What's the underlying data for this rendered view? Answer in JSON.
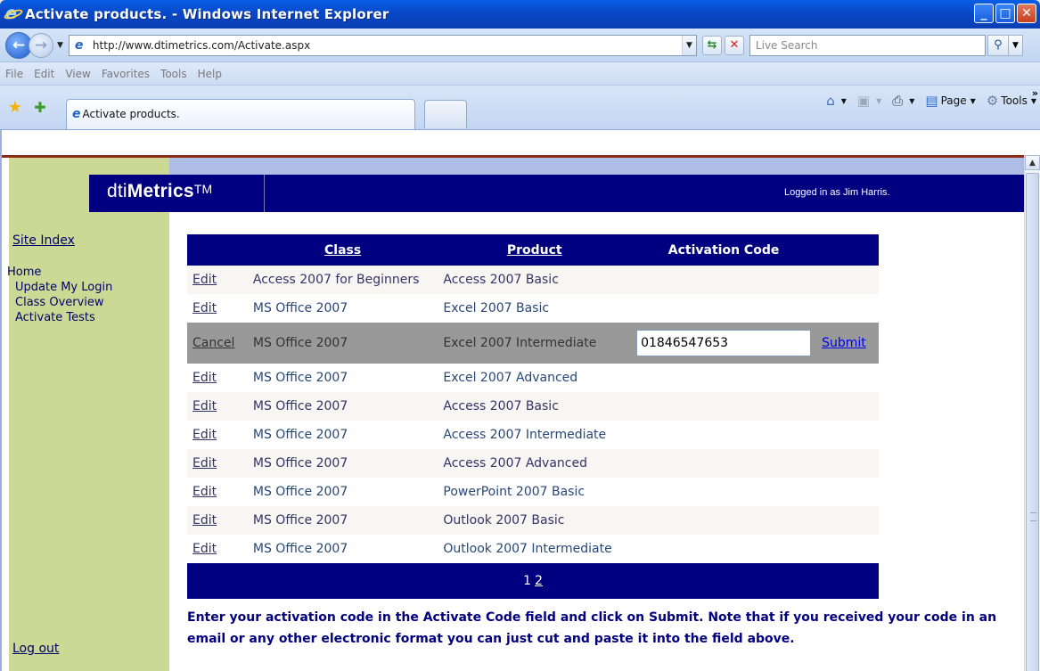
{
  "window": {
    "title": "Activate products. - Windows Internet Explorer"
  },
  "address_bar": {
    "url": "http://www.dtimetrics.com/Activate.aspx",
    "search_placeholder": "Live Search"
  },
  "menu": [
    "File",
    "Edit",
    "View",
    "Favorites",
    "Tools",
    "Help"
  ],
  "tabs": {
    "active_title": "Activate products."
  },
  "command_bar": {
    "page_label": "Page",
    "tools_label": "Tools"
  },
  "site": {
    "logo_prefix": "dti",
    "logo_bold": "Metrics",
    "logo_tm": "TM",
    "logged_in": "Logged in as Jim Harris."
  },
  "sidebar": {
    "site_index": "Site Index",
    "home": "Home",
    "items": [
      "Update My Login",
      "Class Overview",
      "Activate Tests"
    ],
    "logout": "Log out"
  },
  "grid": {
    "headers": {
      "class": "Class",
      "product": "Product",
      "activation_code": "Activation Code"
    },
    "rows": [
      {
        "action": "Edit",
        "class": "Access 2007 for Beginners",
        "product": "Access 2007 Basic"
      },
      {
        "action": "Edit",
        "class": "MS Office 2007",
        "product": "Excel 2007 Basic"
      },
      {
        "action": "Cancel",
        "class": "MS Office 2007",
        "product": "Excel 2007 Intermediate",
        "code": "01846547653",
        "submit": "Submit"
      },
      {
        "action": "Edit",
        "class": "MS Office 2007",
        "product": "Excel 2007 Advanced"
      },
      {
        "action": "Edit",
        "class": "MS Office 2007",
        "product": "Access 2007 Basic"
      },
      {
        "action": "Edit",
        "class": "MS Office 2007",
        "product": "Access 2007 Intermediate"
      },
      {
        "action": "Edit",
        "class": "MS Office 2007",
        "product": "Access 2007 Advanced"
      },
      {
        "action": "Edit",
        "class": "MS Office 2007",
        "product": "PowerPoint 2007 Basic"
      },
      {
        "action": "Edit",
        "class": "MS Office 2007",
        "product": "Outlook 2007 Basic"
      },
      {
        "action": "Edit",
        "class": "MS Office 2007",
        "product": "Outlook 2007 Intermediate"
      }
    ],
    "pager": {
      "current": "1",
      "next": "2"
    }
  },
  "instructions": "Enter your activation code in the Activate Code field and click on Submit. Note that if you received your code in an email or any other electronic format you can just cut and paste it into the field above.",
  "colors": {
    "banner": "#000080",
    "sidebar": "#ccd995",
    "edit_row": "#999999"
  }
}
